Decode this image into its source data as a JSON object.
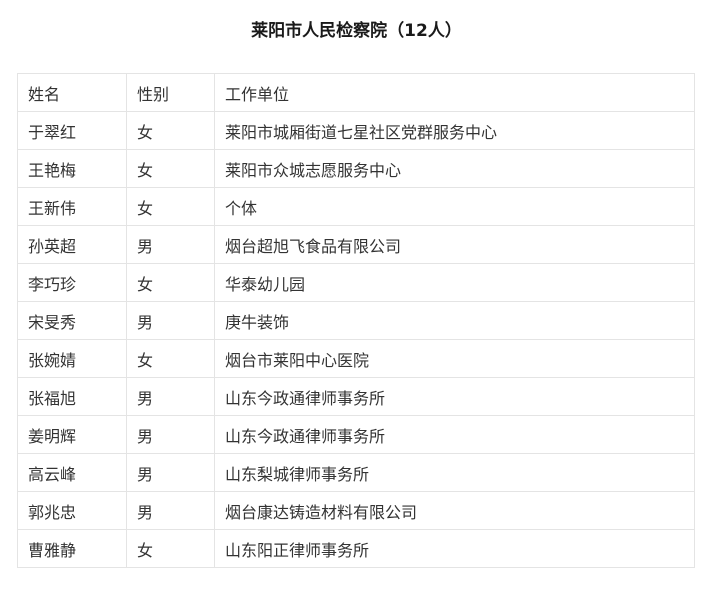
{
  "page": {
    "title": "莱阳市人民检察院（12人）"
  },
  "table": {
    "headers": [
      "姓名",
      "性别",
      "工作单位"
    ],
    "rows": [
      [
        "于翠红",
        "女",
        "莱阳市城厢街道七星社区党群服务中心"
      ],
      [
        "王艳梅",
        "女",
        "莱阳市众城志愿服务中心"
      ],
      [
        "王新伟",
        "女",
        "个体"
      ],
      [
        "孙英超",
        "男",
        "烟台超旭飞食品有限公司"
      ],
      [
        "李巧珍",
        "女",
        "华泰幼儿园"
      ],
      [
        "宋旻秀",
        "男",
        "庚牛装饰"
      ],
      [
        "张婉婧",
        "女",
        "烟台市莱阳中心医院"
      ],
      [
        "张福旭",
        "男",
        "山东今政通律师事务所"
      ],
      [
        "姜明辉",
        "男",
        "山东今政通律师事务所"
      ],
      [
        "高云峰",
        "男",
        "山东梨城律师事务所"
      ],
      [
        "郭兆忠",
        "男",
        "烟台康达铸造材料有限公司"
      ],
      [
        "曹雅静",
        "女",
        "山东阳正律师事务所"
      ]
    ]
  }
}
